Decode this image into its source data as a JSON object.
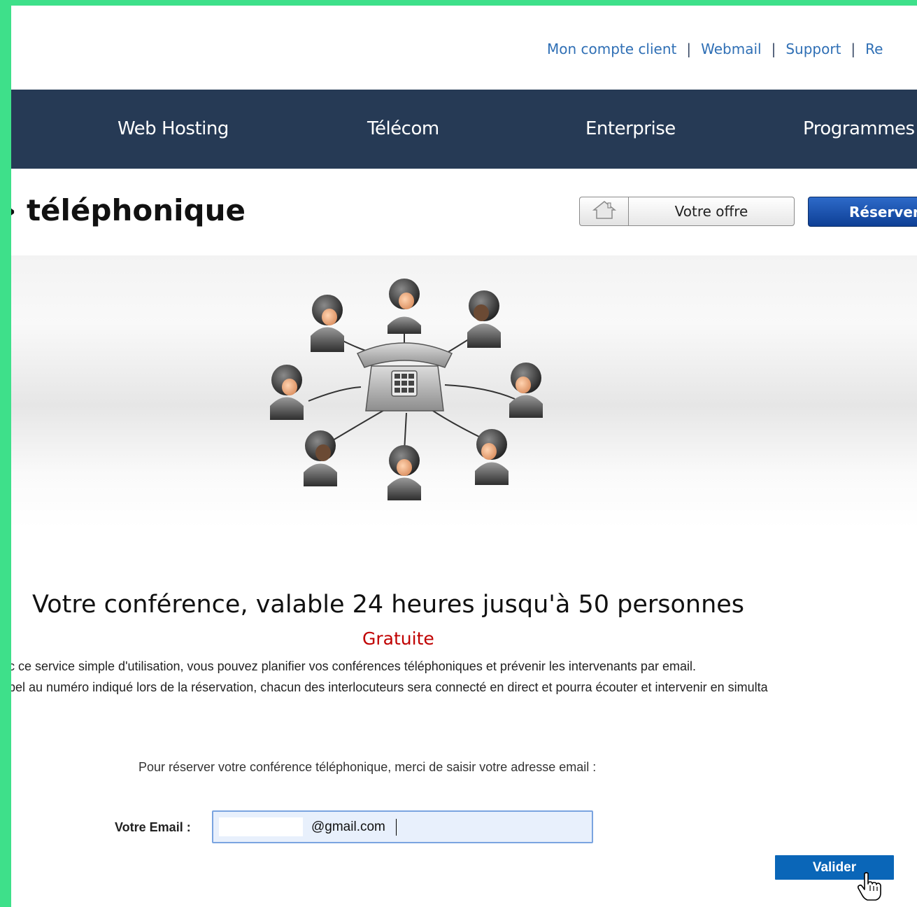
{
  "top_links": [
    "Mon compte client",
    "Webmail",
    "Support",
    "Re"
  ],
  "nav": {
    "items": [
      "Web Hosting",
      "Télécom",
      "Enterprise",
      "Programmes"
    ]
  },
  "page_title": "téléphonique",
  "tabs": {
    "home_icon": "home-icon",
    "offre_label": "Votre offre",
    "reserver_label": "Réserver"
  },
  "banner": {
    "image": "conference-call-illustration"
  },
  "headline": "Votre conférence, valable 24 heures jusqu'à 50 personnes",
  "subheadline": "Gratuite",
  "description": [
    "ec ce service simple d'utilisation, vous pouvez planifier vos conférences téléphoniques et prévenir les intervenants par email.",
    "ppel au numéro indiqué lors de la réservation, chacun des interlocuteurs sera connecté en direct et pourra écouter et intervenir en simulta"
  ],
  "form": {
    "prompt": "Pour réserver votre conférence téléphonique, merci de saisir votre adresse email :",
    "email_label": "Votre Email :",
    "email_value": "@gmail.com",
    "submit_label": "Valider"
  },
  "colors": {
    "frame": "#3ee08a",
    "nav_bg": "#263a55",
    "link": "#2f6fb5",
    "accent_red": "#c00000",
    "button_blue": "#0a66b8"
  }
}
